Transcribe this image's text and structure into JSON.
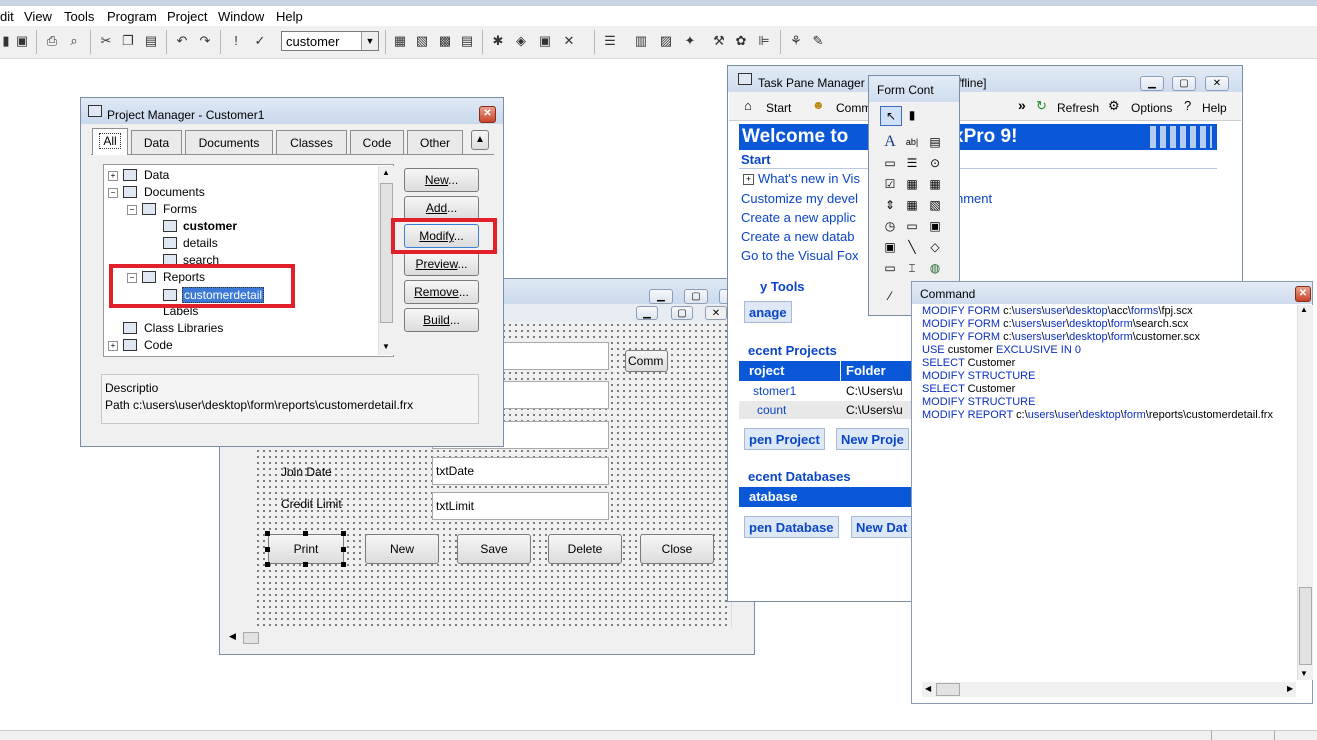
{
  "menu": [
    "dit",
    "View",
    "Tools",
    "Program",
    "Project",
    "Window",
    "Help"
  ],
  "toolbar": {
    "combo_value": "customer"
  },
  "form_designer": {
    "labels": [
      "Join Date",
      "Credit Limit"
    ],
    "textboxes": [
      "txtDate",
      "txtLimit"
    ],
    "partial_button": "Comm",
    "buttons": [
      "Print",
      "New",
      "Save",
      "Delete",
      "Close"
    ]
  },
  "project_manager": {
    "title": "Project Manager - Customer1",
    "tabs": [
      "All",
      "Data",
      "Documents",
      "Classes",
      "Code",
      "Other"
    ],
    "tree": {
      "data": "Data",
      "documents": "Documents",
      "forms": "Forms",
      "forms_items": [
        "customer",
        "details",
        "search"
      ],
      "reports": "Reports",
      "reports_items": [
        "customerdetail"
      ],
      "labels": "Labels",
      "class_libraries": "Class Libraries",
      "code": "Code"
    },
    "buttons": {
      "new_prefix": "New",
      "add_prefix": "Add",
      "modify_prefix": "Modify",
      "preview_prefix": "Preview",
      "remove_prefix": "Remove",
      "build_prefix": "Build",
      "ellipsis": "..."
    },
    "description_label": "Descriptio",
    "path": "Path c:\\users\\user\\desktop\\form\\reports\\customerdetail.frx"
  },
  "task_pane": {
    "title_partial": "Task Pane Manager -",
    "title_suffix": "ffline]",
    "nav": {
      "start": "Start",
      "comm": "Comm",
      "chevrons": "»",
      "refresh": "Refresh",
      "options": "Options",
      "help": "Help"
    },
    "banner_left": "Welcome to",
    "banner_right": "xPro 9!",
    "start_heading": "Start",
    "links": [
      "What's new in Vis",
      "Customize my devel",
      "Create a new applic",
      "Create a new datab",
      "Go to the Visual Fox"
    ],
    "links_right": {
      "customize": "nment"
    },
    "tools_heading": "y Tools",
    "manage_btn": "anage",
    "recent_projects_heading": "ecent Projects",
    "projects_columns": [
      "roject",
      "Folder"
    ],
    "projects_rows": [
      [
        "stomer1",
        "C:\\Users\\u"
      ],
      [
        "count",
        "C:\\Users\\u"
      ]
    ],
    "open_project_btn": "pen Project",
    "new_project_btn": "New Proje",
    "recent_databases_heading": "ecent Databases",
    "database_col": "atabase",
    "open_database_btn": "pen Database",
    "new_database_btn": "New Dat"
  },
  "form_controls": {
    "title": "Form Cont"
  },
  "command": {
    "title": "Command",
    "lines": [
      {
        "kw": "MODIFY FORM",
        "parts": [
          "c:\\",
          "users",
          "\\",
          "user",
          "\\",
          "desktop",
          "\\acc\\",
          "forms",
          "\\fpj.scx"
        ]
      },
      {
        "kw": "MODIFY FORM",
        "parts": [
          "c:\\",
          "users",
          "\\",
          "user",
          "\\",
          "desktop",
          "\\",
          "form",
          "\\search.scx"
        ]
      },
      {
        "kw": "MODIFY FORM",
        "parts": [
          "c:\\",
          "users",
          "\\",
          "user",
          "\\",
          "desktop",
          "\\",
          "form",
          "\\customer.scx"
        ]
      },
      {
        "kw": "USE",
        "parts": [
          "customer",
          " EXCLUSIVE IN ",
          "0"
        ]
      },
      {
        "kw": "SELECT",
        "parts": [
          "Customer"
        ]
      },
      {
        "kw": "MODIFY STRUCTURE",
        "parts": []
      },
      {
        "kw": "SELECT",
        "parts": [
          "Customer"
        ]
      },
      {
        "kw": "MODIFY STRUCTURE",
        "parts": []
      },
      {
        "kw": "MODIFY REPORT",
        "parts": [
          "c:\\",
          "users",
          "\\",
          "user",
          "\\",
          "desktop",
          "\\",
          "form",
          "\\reports\\customerdetail.frx"
        ]
      }
    ]
  }
}
